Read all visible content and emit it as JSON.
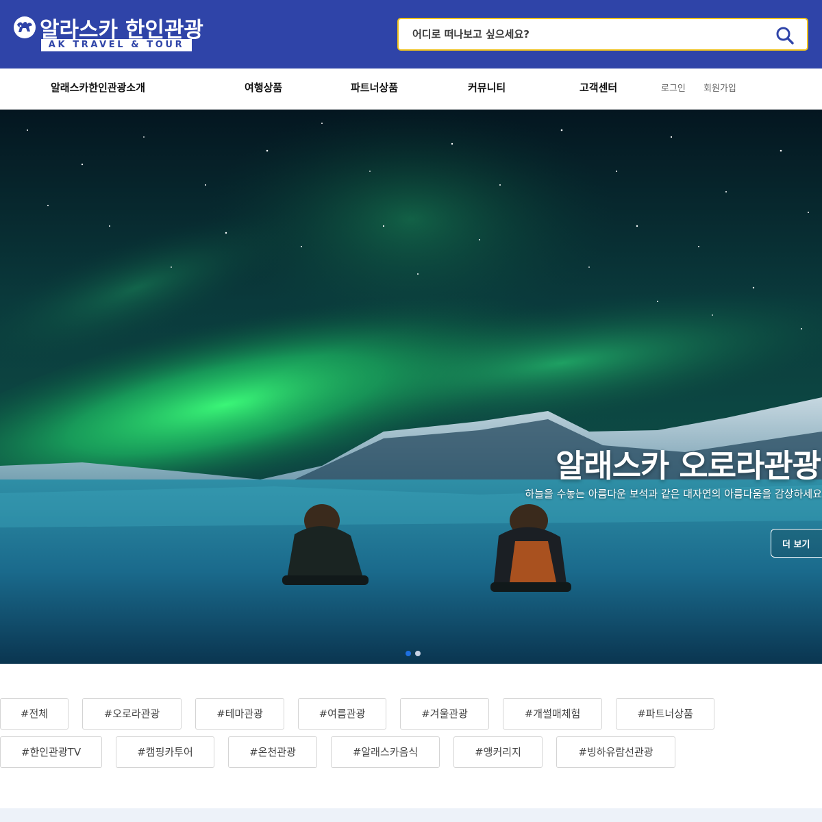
{
  "header": {
    "logo_title": "알라스카 한인관광",
    "logo_subtitle": "AK TRAVEL & TOUR",
    "search_placeholder": "어디로 떠나보고 싶으세요?",
    "brand_color": "#2f44a8",
    "search_border_color": "#f0c31c",
    "search_icon": "search-icon"
  },
  "nav": {
    "items": [
      "알래스카한인관광소개",
      "여행상품",
      "파트너상품",
      "커뮤니티",
      "고객센터"
    ],
    "login": "로그인",
    "signup": "회원가입"
  },
  "hero": {
    "title": "알래스카 오로라관광",
    "subtitle": "하늘을 수놓는 아름다운 보석과 같은 대자연의 아름다움을 감상하세요",
    "more_button": "더 보기",
    "slide_count": 2,
    "active_slide": 1,
    "active_dot_color": "#1e6fe0"
  },
  "tags": {
    "row1": [
      "#전체",
      "#오로라관광",
      "#테마관광",
      "#여름관광",
      "#겨울관광",
      "#개썰매체험",
      "#파트너상품"
    ],
    "row2": [
      "#한인관광TV",
      "#캠핑카투어",
      "#온천관광",
      "#알래스카음식",
      "#앵커리지",
      "#빙하유람선관광"
    ]
  }
}
